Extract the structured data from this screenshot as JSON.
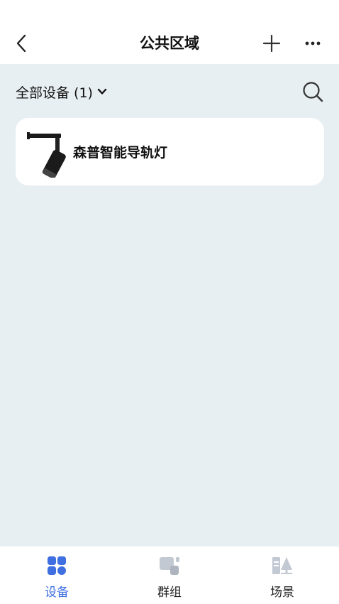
{
  "header": {
    "title": "公共区域",
    "back_icon": "chevron-left-icon",
    "add_icon": "plus-icon",
    "more_icon": "ellipsis-icon"
  },
  "filter": {
    "label": "全部设备 (1)",
    "dropdown_icon": "chevron-down-icon",
    "search_icon": "search-icon"
  },
  "devices": [
    {
      "name": "森普智能导轨灯",
      "icon": "track-light-icon"
    }
  ],
  "tabbar": {
    "tabs": [
      {
        "label": "设备",
        "icon": "devices-grid-icon",
        "active": true
      },
      {
        "label": "群组",
        "icon": "group-icon",
        "active": false
      },
      {
        "label": "场景",
        "icon": "scene-icon",
        "active": false
      }
    ]
  },
  "colors": {
    "accent": "#3f6fe0",
    "background": "#e8eff3",
    "inactive_icon": "#c3c9d2"
  }
}
